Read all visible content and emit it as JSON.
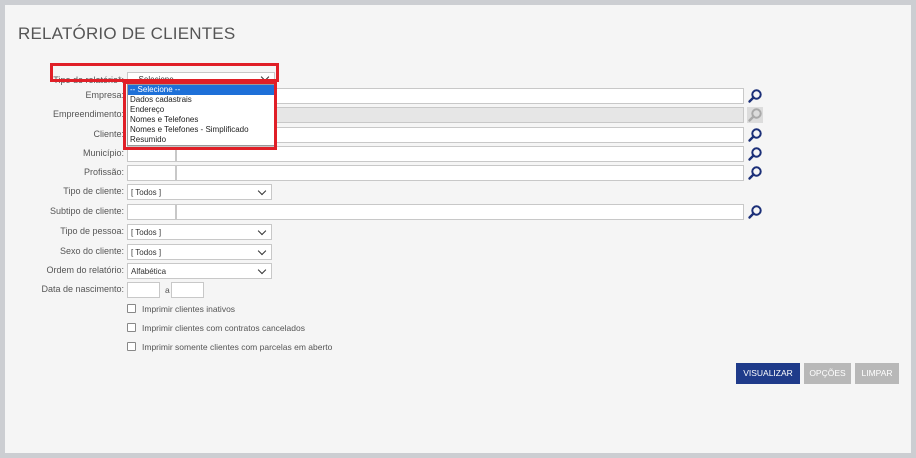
{
  "page": {
    "title": "RELATÓRIO DE CLIENTES"
  },
  "form": {
    "tipo_relatorio": {
      "label": "Tipo de relatório*:",
      "value": "-- Selecione --"
    },
    "empresa": {
      "label": "Empresa:"
    },
    "empreendimento": {
      "label": "Empreendimento:"
    },
    "cliente": {
      "label": "Cliente:"
    },
    "municipio": {
      "label": "Município:"
    },
    "profissao": {
      "label": "Profissão:"
    },
    "tipo_cliente": {
      "label": "Tipo de cliente:",
      "value": "[ Todos ]"
    },
    "subtipo_cliente": {
      "label": "Subtipo de cliente:"
    },
    "tipo_pessoa": {
      "label": "Tipo de pessoa:",
      "value": "[ Todos ]"
    },
    "sexo_cliente": {
      "label": "Sexo do cliente:",
      "value": "[ Todos ]"
    },
    "ordem_relatorio": {
      "label": "Ordem do relatório:",
      "value": "Alfabética"
    },
    "data_nascimento": {
      "label": "Data de nascimento:",
      "separator": "a"
    }
  },
  "dropdown": {
    "options": [
      "-- Selecione --",
      "Dados cadastrais",
      "Endereço",
      "Nomes e Telefones",
      "Nomes e Telefones - Simplificado",
      "Resumido"
    ],
    "highlighted_index": 0
  },
  "checkboxes": [
    {
      "label": "Imprimir clientes inativos",
      "checked": false
    },
    {
      "label": "Imprimir clientes com contratos cancelados",
      "checked": false
    },
    {
      "label": "Imprimir somente clientes com parcelas em aberto",
      "checked": false
    }
  ],
  "buttons": {
    "visualizar": "VISUALIZAR",
    "opcoes": "OPÇÕES",
    "limpar": "LIMPAR"
  },
  "colors": {
    "primary_button": "#1f3b8a",
    "disabled_button": "#b8b8b8",
    "highlight": "#e01f27",
    "icon": "#1b2f78"
  }
}
